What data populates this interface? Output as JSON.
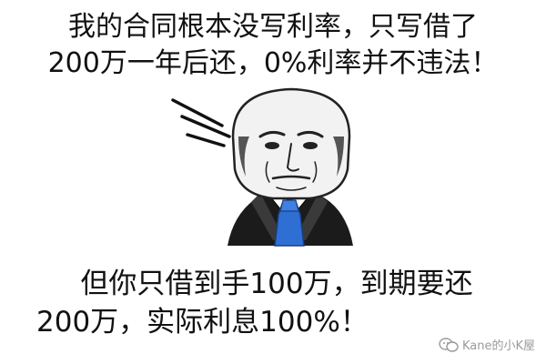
{
  "top_caption": {
    "line1": "我的合同根本没写利率，只写借了",
    "line2": "200万一年后还，0%利率并不违法！"
  },
  "bottom_caption": {
    "line1": "但你只借到手100万，到期要还",
    "line2": "200万，实际利息100%！"
  },
  "watermark": {
    "text": "Kane的小K屋",
    "icon": "wechat-icon"
  },
  "colors": {
    "background": "#ffffff",
    "text": "#111111",
    "tie": "#2f6fd3",
    "watermark": "#9a9a9a"
  }
}
